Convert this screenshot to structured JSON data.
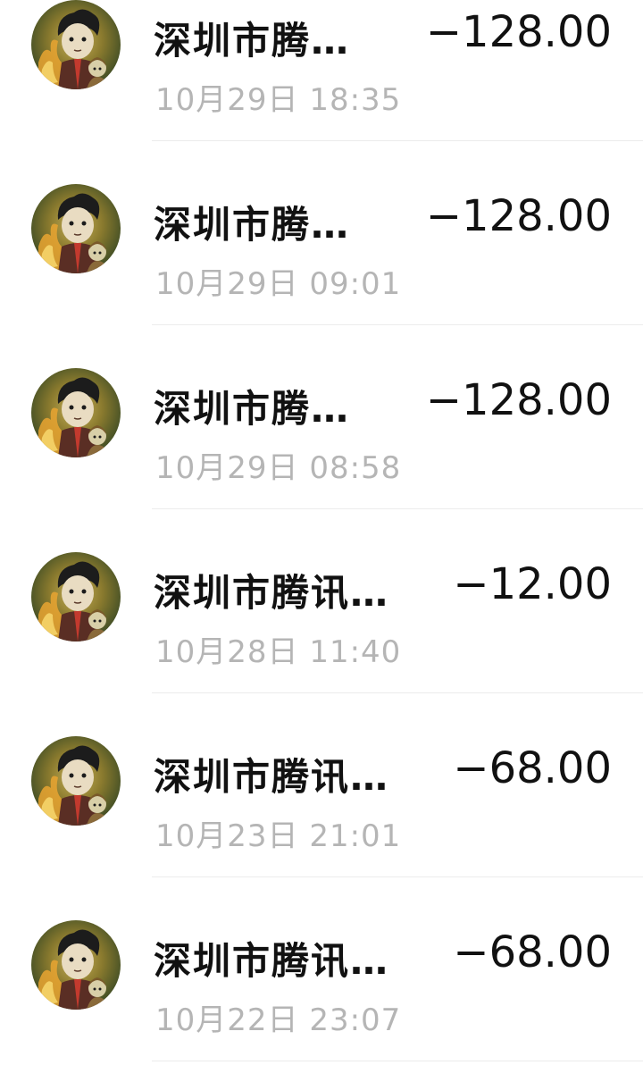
{
  "transactions": [
    {
      "merchant": "深圳市腾…",
      "time": "10月29日 18:35",
      "amount": "−128.00"
    },
    {
      "merchant": "深圳市腾…",
      "time": "10月29日 09:01",
      "amount": "−128.00"
    },
    {
      "merchant": "深圳市腾…",
      "time": "10月29日 08:58",
      "amount": "−128.00"
    },
    {
      "merchant": "深圳市腾讯…",
      "time": "10月28日 11:40",
      "amount": "−12.00"
    },
    {
      "merchant": "深圳市腾讯…",
      "time": "10月23日 21:01",
      "amount": "−68.00"
    },
    {
      "merchant": "深圳市腾讯…",
      "time": "10月22日 23:07",
      "amount": "−68.00"
    }
  ]
}
